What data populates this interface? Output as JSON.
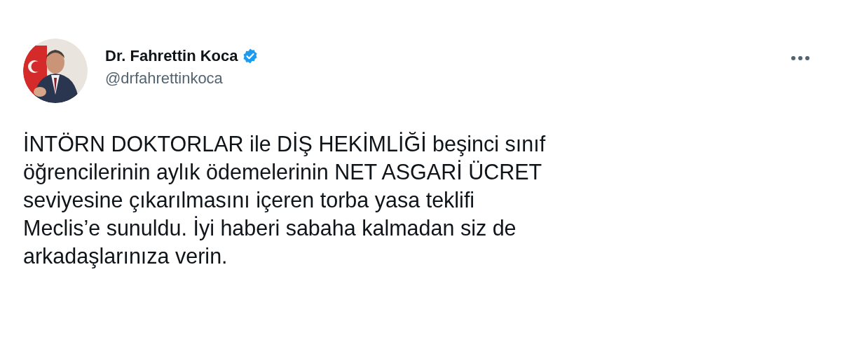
{
  "author": {
    "name": "Dr. Fahrettin Koca",
    "verified": true,
    "handle": "@drfahrettinkoca"
  },
  "tweet": {
    "text": "İNTÖRN DOKTORLAR ile DİŞ HEKİMLİĞİ beşinci sınıf\nöğrencilerinin aylık ödemelerinin NET ASGARİ ÜCRET\nseviyesine çıkarılmasını içeren torba yasa teklifi\nMeclis’e sunuldu. İyi haberi sabaha kalmadan siz de\narkadaşlarınıza verin."
  }
}
